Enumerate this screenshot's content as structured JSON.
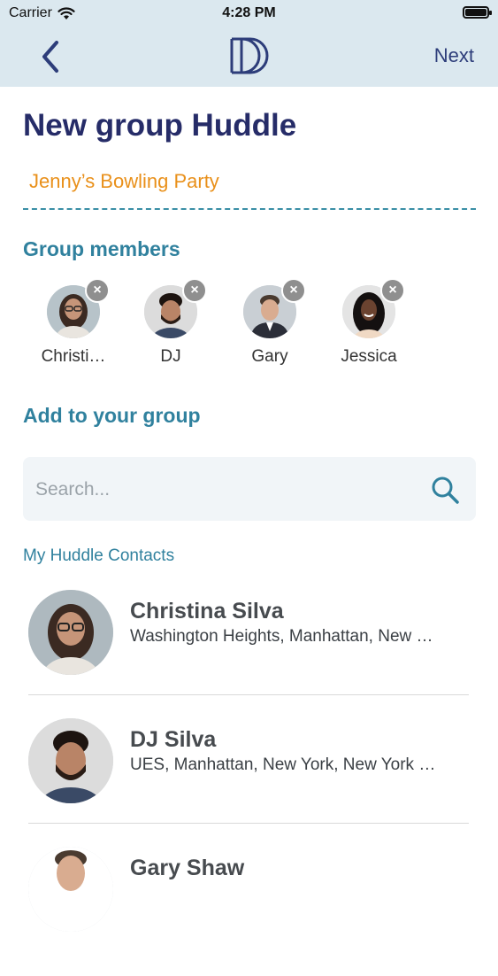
{
  "status_bar": {
    "carrier": "Carrier",
    "time": "4:28 PM"
  },
  "nav": {
    "next_label": "Next"
  },
  "title": "New group Huddle",
  "group_name": "Jenny’s Bowling Party",
  "members_heading": "Group members",
  "members": [
    {
      "name": "Christi…"
    },
    {
      "name": "DJ"
    },
    {
      "name": "Gary"
    },
    {
      "name": "Jessica"
    }
  ],
  "remove_glyph": "×",
  "add_heading": "Add to your group",
  "search": {
    "placeholder": "Search..."
  },
  "contacts_heading": "My Huddle Contacts",
  "contacts": [
    {
      "name": "Christina Silva",
      "location": "Washington Heights, Manhattan, New …"
    },
    {
      "name": "DJ Silva",
      "location": "UES, Manhattan, New York, New York …"
    },
    {
      "name": "Gary Shaw",
      "location": ""
    }
  ],
  "colors": {
    "header_bg": "#dbe8ef",
    "title": "#262c68",
    "accent": "#30819e",
    "group_name": "#e9901a"
  }
}
